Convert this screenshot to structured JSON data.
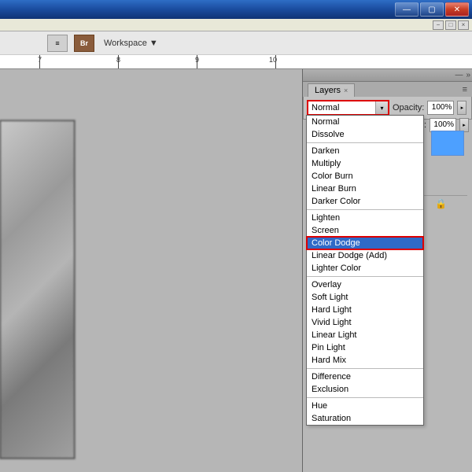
{
  "window": {
    "minimize_label": "—",
    "maximize_label": "▢",
    "close_label": "✕",
    "mini_min": "−",
    "mini_max": "□",
    "mini_close": "×"
  },
  "toolbar": {
    "doc_icon": "≡",
    "br_label": "Br",
    "workspace_label": "Workspace",
    "workspace_arrow": "▼"
  },
  "ruler": {
    "ticks": [
      "7",
      "8",
      "9",
      "10"
    ]
  },
  "layers": {
    "tab_label": "Layers",
    "tab_close": "×",
    "panel_head_dash": "—",
    "panel_head_chev": "»",
    "menu_lines": "≡",
    "blend_current": "Normal",
    "combo_arrow": "▾",
    "opacity_label": "Opacity:",
    "opacity_value": "100%",
    "fill_label": "Fill:",
    "fill_value": "100%",
    "arrow_right": "▸",
    "lock_icon": "🔒"
  },
  "blend_modes": {
    "groups": [
      [
        "Normal",
        "Dissolve"
      ],
      [
        "Darken",
        "Multiply",
        "Color Burn",
        "Linear Burn",
        "Darker Color"
      ],
      [
        "Lighten",
        "Screen",
        "Color Dodge",
        "Linear Dodge (Add)",
        "Lighter Color"
      ],
      [
        "Overlay",
        "Soft Light",
        "Hard Light",
        "Vivid Light",
        "Linear Light",
        "Pin Light",
        "Hard Mix"
      ],
      [
        "Difference",
        "Exclusion"
      ],
      [
        "Hue",
        "Saturation"
      ]
    ],
    "selected": "Color Dodge"
  }
}
